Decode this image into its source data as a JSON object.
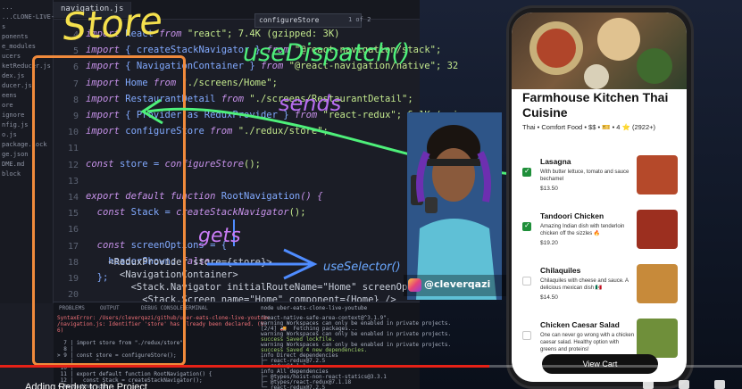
{
  "editor": {
    "tab_label": "navigation.js",
    "find_value": "configureStore",
    "find_count": "1 of 2",
    "explorer_items": [
      "...",
      "...CLONE-LIVE-YOU...",
      "s",
      "ponents",
      "e_modules",
      "ucers",
      "ketReducer.js",
      "dex.js",
      "ducer.js",
      "eens",
      "ore",
      "ignore",
      "nfig.js",
      "o.js",
      "package.lock",
      "ge.json",
      "DME.md",
      "block"
    ],
    "line_numbers": [
      "4",
      "5",
      "6",
      "7",
      "8",
      "9",
      "10",
      "11",
      "12",
      "13",
      "14",
      "15",
      "16",
      "17",
      "18",
      "19",
      "20",
      "21"
    ],
    "code_lines": [
      {
        "a": "import ",
        "b": "React ",
        "c": "from ",
        "d": "\"react\"; 7.4K (gzipped: 3K)"
      },
      {
        "a": "import ",
        "b": "{ createStackNavigator } ",
        "c": "from ",
        "d": "\"@react-navigation/stack\";"
      },
      {
        "a": "import ",
        "b": "{ NavigationContainer } ",
        "c": "from ",
        "d": "\"@react-navigation/native\"; 32"
      },
      {
        "a": "import ",
        "b": "Home ",
        "c": "from ",
        "d": "\"./screens/Home\";"
      },
      {
        "a": "import ",
        "b": "RestaurantDetail ",
        "c": "from ",
        "d": "\"./screens/RestaurantDetail\";"
      },
      {
        "a": "import ",
        "b": "{ Provider as ReduxProvider } ",
        "c": "from ",
        "d": "\"react-redux\"; 6.1K (gzip"
      },
      {
        "a": "import ",
        "b": "configureStore ",
        "c": "from ",
        "d": "\"./redux/store\";"
      },
      {
        "a": "",
        "b": "",
        "c": "",
        "d": ""
      },
      {
        "a": "const ",
        "b": "store = ",
        "c": "configureStore",
        "d": "();"
      },
      {
        "a": "",
        "b": "",
        "c": "",
        "d": ""
      },
      {
        "a": "export default function ",
        "b": "RootNavigation",
        "c": "() {",
        "d": ""
      },
      {
        "a": "  const ",
        "b": "Stack = ",
        "c": "createStackNavigator",
        "d": "();"
      },
      {
        "a": "",
        "b": "",
        "c": "",
        "d": ""
      },
      {
        "a": "  const ",
        "b": "screenOptions = {",
        "c": "",
        "d": ""
      },
      {
        "a": "    ",
        "b": "headerShown: ",
        "c": "false",
        "d": ","
      },
      {
        "a": "  ",
        "b": "};",
        "c": "",
        "d": ""
      },
      {
        "a": "",
        "b": "",
        "c": "",
        "d": ""
      },
      {
        "a": "  return ",
        "b": "(",
        "c": "",
        "d": ""
      }
    ],
    "code_tail": [
      "    <ReduxProvider store={store}>",
      "      <NavigationContainer>",
      "        <Stack.Navigator initialRouteName=\"Home\" screenOptions={scr",
      "          <Stack.Screen name=\"Home\" component={Home} />"
    ],
    "panel_tabs": [
      "PROBLEMS",
      "OUTPUT",
      "DEBUG CONSOLE",
      "TERMINAL"
    ],
    "terminal_left": [
      "SyntaxError: /Users/cleverqazi/github/uber-eats-clone-live-youtube",
      "/navigation.js: Identifier 'store' has already been declared. (9:",
      "6)",
      "",
      "  7 | import store from \"./redux/store\";",
      "  8 |",
      "> 9 | const store = configureStore();",
      "    |       ^",
      " 10 |",
      " 11 | export default function RootNavigation() {",
      " 12 |   const Stack = createStackNavigator();",
      "• Reloading apps"
    ],
    "terminal_right": [
      "\"react-native-safe-area-context@^3.1.9\".",
      "warning Workspaces can only be enabled in private projects.",
      "[2/4] 🚚  Fetching packages...",
      "warning Workspaces can only be enabled in private projects.",
      "success Saved lockfile.",
      "warning Workspaces can only be enabled in private projects.",
      "success Saved 4 new dependencies.",
      "info Direct dependencies",
      "├─ react-redux@7.2.5",
      "└─ redux@4.1.1",
      "info All dependencies",
      "├─ @types/hoist-non-react-statics@3.3.1",
      "├─ @types/react-redux@7.1.18",
      "└─ react-redux@7.2.5"
    ],
    "terminal_title": "node uber-eats-clone-live-youtube"
  },
  "annotations": {
    "store": "Store",
    "use_dispatch": "useDispatch()",
    "sends": "sends",
    "gets": "gets",
    "use_selector": "useSelector()"
  },
  "webcam": {
    "handle": "@cleverqazi"
  },
  "phone": {
    "restaurant_name": "Farmhouse Kitchen Thai Cuisine",
    "restaurant_meta": "Thai • Comfort Food • $$ • 🎫 • 4 ⭐ (2922+)",
    "items": [
      {
        "name": "Lasagna",
        "desc": "With butter lettuce, tomato and sauce bechamel",
        "price": "$13.50",
        "checked": true,
        "thumb": "#b5492a"
      },
      {
        "name": "Tandoori Chicken",
        "desc": "Amazing Indian dish with tenderloin chicken off the sizzles 🔥",
        "price": "$19.20",
        "checked": true,
        "thumb": "#9c2f1f"
      },
      {
        "name": "Chilaquiles",
        "desc": "Chilaquiles with cheese and sauce. A delicious mexican dish 🇲🇽",
        "price": "$14.50",
        "checked": false,
        "thumb": "#c78a3a"
      },
      {
        "name": "Chicken Caesar Salad",
        "desc": "One can never go wrong with a chicken caesar salad. Healthy option with greens and proteins!",
        "price": "",
        "checked": false,
        "thumb": "#6f8f3a"
      }
    ],
    "view_cart": "View Cart"
  },
  "video": {
    "title": "Adding Redux to the Project",
    "progress": 0.66,
    "colors": {
      "progress": "#e62117",
      "annotation_orange": "#f08a3c",
      "annotation_green": "#4ef07a"
    }
  }
}
